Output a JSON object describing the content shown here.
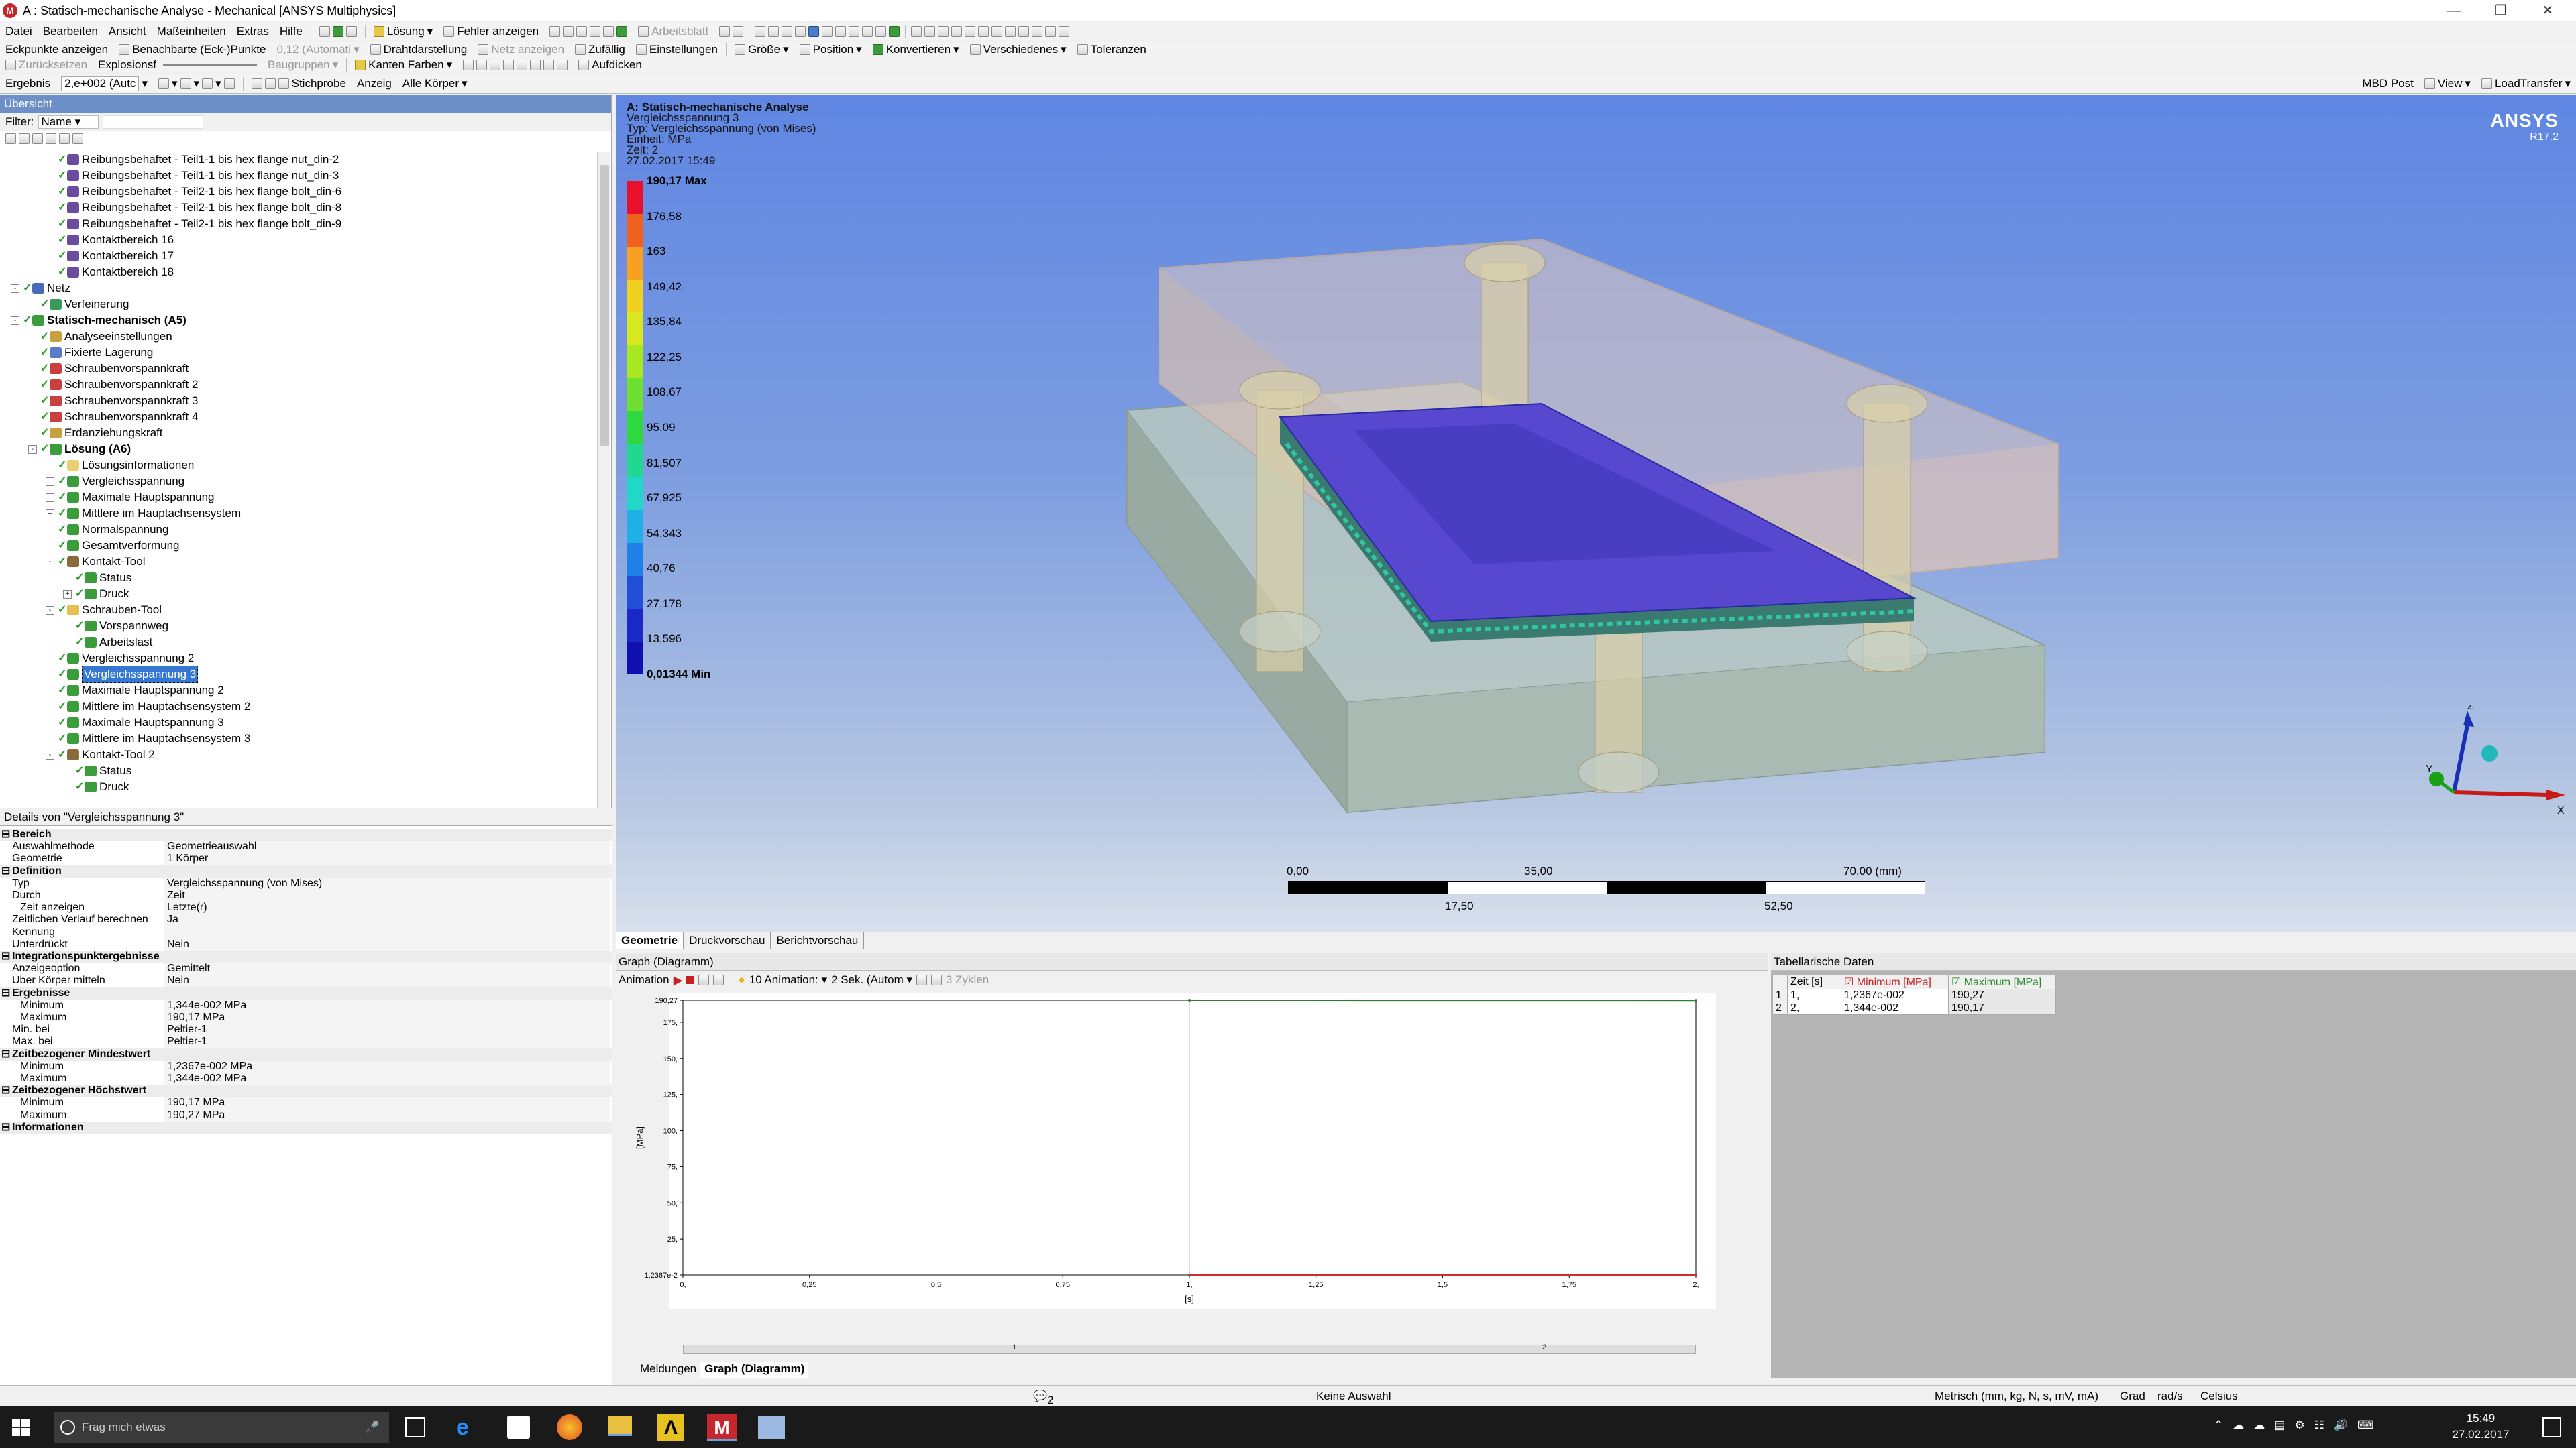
{
  "window": {
    "title": "A : Statisch-mechanische Analyse - Mechanical [ANSYS Multiphysics]",
    "icon": "M"
  },
  "menu": [
    "Datei",
    "Bearbeiten",
    "Ansicht",
    "Maßeinheiten",
    "Extras",
    "Hilfe"
  ],
  "toolbar1": {
    "solve": "Lösung",
    "show_errors": "Fehler anzeigen",
    "worksheet": "Arbeitsblatt"
  },
  "toolbar2": {
    "corner_points": "Eckpunkte anzeigen",
    "neighbor_nodes": "Benachbarte (Eck-)Punkte",
    "scale_value": "0,12 (Automati",
    "wireframe": "Drahtdarstellung",
    "show_mesh": "Netz anzeigen",
    "random": "Zufällig",
    "settings": "Einstellungen",
    "size": "Größe",
    "position": "Position",
    "convert": "Konvertieren",
    "misc": "Verschiedenes",
    "tolerances": "Toleranzen"
  },
  "toolbar3": {
    "zoom_bar": "Zurücksetzen",
    "explosion": "Explosionsf",
    "assemblies": "Baugruppen",
    "edge_colors": "Kanten Farben",
    "thicken": "Aufdicken"
  },
  "toolbar4": {
    "result_label": "Ergebnis",
    "result_value": "2,e+002 (Autc",
    "probe": "Stichprobe",
    "display_label": "Anzeig",
    "display_value": "Alle Körper",
    "mbd_post": "MBD Post",
    "view": "View",
    "loadtransfer": "LoadTransfer"
  },
  "outline": {
    "header": "Übersicht",
    "filter_label": "Filter:",
    "filter_value": "Name",
    "items": [
      {
        "label": "Reibungsbehaftet - Teil1-1 bis hex flange nut_din-2",
        "level": 2,
        "icon": "contact-icon",
        "color": "#6a4c9c"
      },
      {
        "label": "Reibungsbehaftet - Teil1-1 bis hex flange nut_din-3",
        "level": 2,
        "icon": "contact-icon",
        "color": "#6a4c9c"
      },
      {
        "label": "Reibungsbehaftet - Teil2-1 bis hex flange bolt_din-6",
        "level": 2,
        "icon": "contact-icon",
        "color": "#6a4c9c"
      },
      {
        "label": "Reibungsbehaftet - Teil2-1 bis hex flange bolt_din-8",
        "level": 2,
        "icon": "contact-icon",
        "color": "#6a4c9c"
      },
      {
        "label": "Reibungsbehaftet - Teil2-1 bis hex flange bolt_din-9",
        "level": 2,
        "icon": "contact-icon",
        "color": "#6a4c9c"
      },
      {
        "label": "Kontaktbereich 16",
        "level": 2,
        "icon": "contact-icon",
        "color": "#6a4c9c"
      },
      {
        "label": "Kontaktbereich 17",
        "level": 2,
        "icon": "contact-icon",
        "color": "#6a4c9c"
      },
      {
        "label": "Kontaktbereich 18",
        "level": 2,
        "icon": "contact-icon",
        "color": "#6a4c9c"
      },
      {
        "label": "Netz",
        "level": 0,
        "icon": "mesh-icon",
        "color": "#4a6ab8",
        "toggle": "-"
      },
      {
        "label": "Verfeinerung",
        "level": 1,
        "icon": "refinement-icon",
        "color": "#3a9a5a"
      },
      {
        "label": "Statisch-mechanisch (A5)",
        "level": 0,
        "icon": "static-structural-icon",
        "color": "#3c9c3c",
        "toggle": "-",
        "bold": true
      },
      {
        "label": "Analyseeinstellungen",
        "level": 1,
        "icon": "analysis-settings-icon",
        "color": "#c8a040"
      },
      {
        "label": "Fixierte Lagerung",
        "level": 1,
        "icon": "fixed-support-icon",
        "color": "#5a7ac8"
      },
      {
        "label": "Schraubenvorspannkraft",
        "level": 1,
        "icon": "bolt-pretension-icon",
        "color": "#c84040"
      },
      {
        "label": "Schraubenvorspannkraft 2",
        "level": 1,
        "icon": "bolt-pretension-icon",
        "color": "#c84040"
      },
      {
        "label": "Schraubenvorspannkraft 3",
        "level": 1,
        "icon": "bolt-pretension-icon",
        "color": "#c84040"
      },
      {
        "label": "Schraubenvorspannkraft 4",
        "level": 1,
        "icon": "bolt-pretension-icon",
        "color": "#c84040"
      },
      {
        "label": "Erdanziehungskraft",
        "level": 1,
        "icon": "gravity-icon",
        "color": "#c8a040"
      },
      {
        "label": "Lösung (A6)",
        "level": 1,
        "icon": "solution-icon",
        "color": "#3c9c3c",
        "toggle": "-",
        "bold": true
      },
      {
        "label": "Lösungsinformationen",
        "level": 2,
        "icon": "solution-info-icon",
        "color": "#e8d070"
      },
      {
        "label": "Vergleichsspannung",
        "level": 2,
        "icon": "result-icon",
        "color": "#3c9c3c",
        "toggle": "+"
      },
      {
        "label": "Maximale Hauptspannung",
        "level": 2,
        "icon": "result-icon",
        "color": "#3c9c3c",
        "toggle": "+"
      },
      {
        "label": "Mittlere im Hauptachsensystem",
        "level": 2,
        "icon": "result-icon",
        "color": "#3c9c3c",
        "toggle": "+"
      },
      {
        "label": "Normalspannung",
        "level": 2,
        "icon": "result-icon",
        "color": "#3c9c3c"
      },
      {
        "label": "Gesamtverformung",
        "level": 2,
        "icon": "result-icon",
        "color": "#3c9c3c"
      },
      {
        "label": "Kontakt-Tool",
        "level": 2,
        "icon": "contact-tool-icon",
        "color": "#8a6a3a",
        "toggle": "-"
      },
      {
        "label": "Status",
        "level": 3,
        "icon": "result-icon",
        "color": "#3c9c3c"
      },
      {
        "label": "Druck",
        "level": 3,
        "icon": "result-icon",
        "color": "#3c9c3c",
        "toggle": "+"
      },
      {
        "label": "Schrauben-Tool",
        "level": 2,
        "icon": "bolt-tool-icon",
        "color": "#e8c050",
        "toggle": "-"
      },
      {
        "label": "Vorspannweg",
        "level": 3,
        "icon": "result-icon",
        "color": "#3c9c3c"
      },
      {
        "label": "Arbeitslast",
        "level": 3,
        "icon": "result-icon",
        "color": "#3c9c3c"
      },
      {
        "label": "Vergleichsspannung 2",
        "level": 2,
        "icon": "result-icon",
        "color": "#3c9c3c"
      },
      {
        "label": "Vergleichsspannung 3",
        "level": 2,
        "icon": "result-icon",
        "color": "#3c9c3c",
        "selected": true
      },
      {
        "label": "Maximale Hauptspannung 2",
        "level": 2,
        "icon": "result-icon",
        "color": "#3c9c3c"
      },
      {
        "label": "Mittlere im Hauptachsensystem 2",
        "level": 2,
        "icon": "result-icon",
        "color": "#3c9c3c"
      },
      {
        "label": "Maximale Hauptspannung 3",
        "level": 2,
        "icon": "result-icon",
        "color": "#3c9c3c"
      },
      {
        "label": "Mittlere im Hauptachsensystem 3",
        "level": 2,
        "icon": "result-icon",
        "color": "#3c9c3c"
      },
      {
        "label": "Kontakt-Tool 2",
        "level": 2,
        "icon": "contact-tool-icon",
        "color": "#8a6a3a",
        "toggle": "-"
      },
      {
        "label": "Status",
        "level": 3,
        "icon": "result-icon",
        "color": "#3c9c3c"
      },
      {
        "label": "Druck",
        "level": 3,
        "icon": "result-icon",
        "color": "#3c9c3c"
      }
    ]
  },
  "details": {
    "header": "Details von \"Vergleichsspannung 3\"",
    "rows": [
      {
        "type": "cat",
        "k": "Bereich"
      },
      {
        "k": "Auswahlmethode",
        "v": "Geometrieauswahl"
      },
      {
        "k": "Geometrie",
        "v": "1 Körper"
      },
      {
        "type": "cat",
        "k": "Definition"
      },
      {
        "k": "Typ",
        "v": "Vergleichsspannung (von Mises)"
      },
      {
        "k": "Durch",
        "v": "Zeit"
      },
      {
        "k": "Zeit anzeigen",
        "v": "Letzte(r)",
        "sub": true
      },
      {
        "k": "Zeitlichen Verlauf berechnen",
        "v": "Ja"
      },
      {
        "k": "Kennung",
        "v": ""
      },
      {
        "k": "Unterdrückt",
        "v": "Nein"
      },
      {
        "type": "cat",
        "k": "Integrationspunktergebnisse"
      },
      {
        "k": "Anzeigeoption",
        "v": "Gemittelt"
      },
      {
        "k": "Über Körper mitteln",
        "v": "Nein"
      },
      {
        "type": "cat",
        "k": "Ergebnisse"
      },
      {
        "k": "Minimum",
        "v": "1,344e-002 MPa",
        "sub": true
      },
      {
        "k": "Maximum",
        "v": "190,17 MPa",
        "sub": true
      },
      {
        "k": "Min. bei",
        "v": "Peltier-1"
      },
      {
        "k": "Max. bei",
        "v": "Peltier-1"
      },
      {
        "type": "cat",
        "k": "Zeitbezogener Mindestwert"
      },
      {
        "k": "Minimum",
        "v": "1,2367e-002 MPa",
        "sub": true
      },
      {
        "k": "Maximum",
        "v": "1,344e-002 MPa",
        "sub": true
      },
      {
        "type": "cat",
        "k": "Zeitbezogener Höchstwert"
      },
      {
        "k": "Minimum",
        "v": "190,17 MPa",
        "sub": true
      },
      {
        "k": "Maximum",
        "v": "190,27 MPa",
        "sub": true
      },
      {
        "type": "cat",
        "k": "Informationen"
      }
    ]
  },
  "viewport": {
    "title": "A: Statisch-mechanische Analyse",
    "lines": [
      "Vergleichsspannung 3",
      "Typ: Vergleichsspannung (von Mises)",
      "Einheit: MPa",
      "Zeit: 2",
      "27.02.2017 15:49"
    ],
    "brand": "ANSYS",
    "version": "R17.2",
    "legend": [
      {
        "label": "190,17 Max",
        "color": "#e8102a",
        "bold": true
      },
      {
        "label": "176,58",
        "color": "#f06020"
      },
      {
        "label": "163",
        "color": "#f8a020"
      },
      {
        "label": "149,42",
        "color": "#f0d020"
      },
      {
        "label": "135,84",
        "color": "#d8e820"
      },
      {
        "label": "122,25",
        "color": "#a8e820"
      },
      {
        "label": "108,67",
        "color": "#70e030"
      },
      {
        "label": "95,09",
        "color": "#30d840"
      },
      {
        "label": "81,507",
        "color": "#20d890"
      },
      {
        "label": "67,925",
        "color": "#20d8c8"
      },
      {
        "label": "54,343",
        "color": "#20b0e8"
      },
      {
        "label": "40,76",
        "color": "#2080e8"
      },
      {
        "label": "27,178",
        "color": "#2050d8"
      },
      {
        "label": "13,596",
        "color": "#1a28c8"
      },
      {
        "label": "0,01344 Min",
        "color": "#1010b0",
        "bold": true
      }
    ],
    "scale": {
      "t0": "0,00",
      "t1": "35,00",
      "t2": "70,00 (mm)",
      "b1": "17,50",
      "b2": "52,50"
    },
    "axes": {
      "x": "X",
      "y": "Y",
      "z": "Z"
    }
  },
  "view_tabs": [
    "Geometrie",
    "Druckvorschau",
    "Berichtvorschau"
  ],
  "graph": {
    "header": "Graph (Diagramm)",
    "animation_label": "Animation",
    "frames": "10 Animation:",
    "duration": "2 Sek. (Autom",
    "cycles": "3 Zyklen",
    "bottom_tabs": [
      "Meldungen",
      "Graph (Diagramm)"
    ],
    "timeline_marks": [
      "1",
      "2"
    ]
  },
  "chart_data": {
    "type": "line",
    "xlabel": "[s]",
    "ylabel": "[MPa]",
    "x_ticks": [
      "0,",
      "0,25",
      "0,5",
      "0,75",
      "1,",
      "1,25",
      "1,5",
      "1,75",
      "2,"
    ],
    "y_ticks": [
      "1,2367e-2",
      "25,",
      "50,",
      "75,",
      "100,",
      "125,",
      "150,",
      "175,",
      "190,27"
    ],
    "xlim": [
      0,
      2
    ],
    "ylim": [
      0.012367,
      190.27
    ],
    "series": [
      {
        "values": [
          190.27,
          190.17
        ],
        "x": [
          1,
          2
        ],
        "color": "#2f7a2f"
      },
      {
        "values": [
          0.012367,
          0.01344
        ],
        "x": [
          1,
          2
        ],
        "color": "#c83030"
      }
    ]
  },
  "tabular": {
    "header": "Tabellarische Daten",
    "columns": [
      "Zeit [s]",
      "Minimum [MPa]",
      "Maximum [MPa]"
    ],
    "rows": [
      [
        "1",
        "1,",
        "1,2367e-002",
        "190,27"
      ],
      [
        "2",
        "2,",
        "1,344e-002",
        "190,17"
      ]
    ]
  },
  "status": {
    "messages": "2 Meldungen",
    "selection": "Keine Auswahl",
    "units": "Metrisch (mm, kg, N, s, mV, mA)",
    "deg": "Grad",
    "rad": "rad/s",
    "temp": "Celsius"
  },
  "taskbar": {
    "search": "Frag mich etwas",
    "time": "15:49",
    "date": "27.02.2017"
  }
}
